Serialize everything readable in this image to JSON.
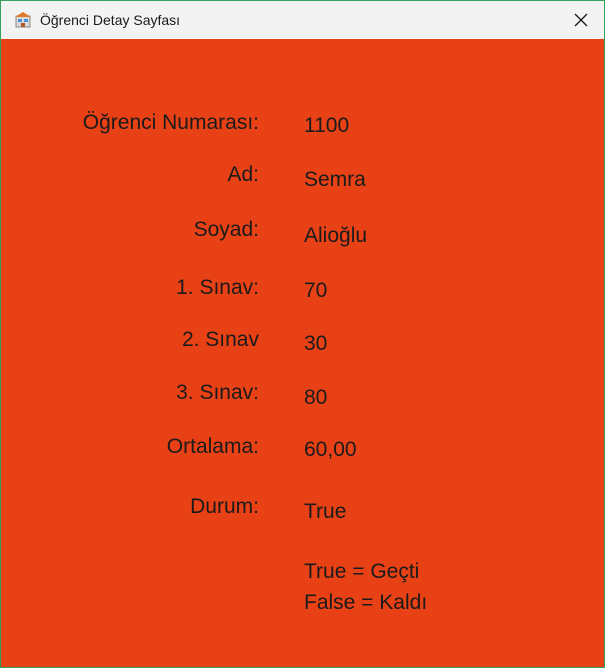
{
  "window": {
    "title": "Öğrenci Detay Sayfası",
    "app_icon": "app-window-icon",
    "close_icon": "close-icon",
    "background_color": "#e84116",
    "border_color": "#35a05a"
  },
  "fields": {
    "student_number": {
      "label": "Öğrenci Numarası:",
      "value": "1100"
    },
    "first_name": {
      "label": "Ad:",
      "value": "Semra"
    },
    "last_name": {
      "label": "Soyad:",
      "value": "Alioğlu"
    },
    "exam1": {
      "label": "1. Sınav:",
      "value": "70"
    },
    "exam2": {
      "label": "2. Sınav",
      "value": "30"
    },
    "exam3": {
      "label": "3. Sınav:",
      "value": "80"
    },
    "average": {
      "label": "Ortalama:",
      "value": "60,00"
    },
    "status": {
      "label": "Durum:",
      "value": "True"
    }
  },
  "legend": {
    "line1": "True = Geçti",
    "line2": "False = Kaldı"
  }
}
